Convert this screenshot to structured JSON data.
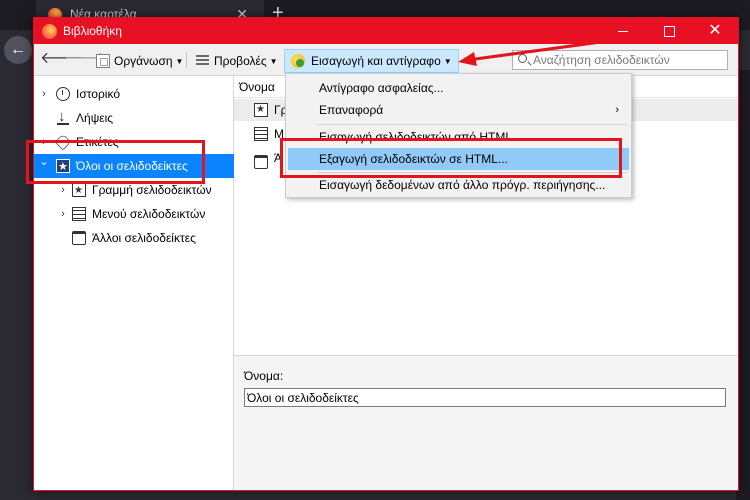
{
  "browser": {
    "tab_title": "Νέα καρτέλα",
    "tab_close": "✕",
    "new_tab": "+",
    "back": "←"
  },
  "window": {
    "title": "Βιβλιοθήκη",
    "minimize": "",
    "maximize": "",
    "close": "✕",
    "accent_color": "#e81123"
  },
  "toolbar": {
    "back": "🡐",
    "forward": "🡒",
    "organize": "Οργάνωση",
    "views": "Προβολές",
    "import_backup": "Εισαγωγή και αντίγραφο",
    "search_placeholder": "Αναζήτηση σελιδοδεικτών"
  },
  "sidebar": {
    "items": [
      {
        "label": "Ιστορικό",
        "icon": "clock-icon",
        "twisty": "›"
      },
      {
        "label": "Λήψεις",
        "icon": "download-icon",
        "twisty": ""
      },
      {
        "label": "Ετικέτες",
        "icon": "tag-icon",
        "twisty": "›"
      },
      {
        "label": "Όλοι οι σελιδοδείκτες",
        "icon": "bookmark-star-icon",
        "twisty": "⌄",
        "selected": true
      },
      {
        "label": "Γραμμή σελιδοδεικτών",
        "icon": "bookmarks-toolbar-icon",
        "twisty": "›"
      },
      {
        "label": "Μενού σελιδοδεικτών",
        "icon": "bookmarks-menu-icon",
        "twisty": "›"
      },
      {
        "label": "Άλλοι σελιδοδείκτες",
        "icon": "other-bookmarks-icon",
        "twisty": ""
      }
    ],
    "selected_color": "#0a84ff"
  },
  "list": {
    "column_name": "Όνομα",
    "rows": [
      {
        "label": "Γρ",
        "icon": "bookmarks-toolbar-icon"
      },
      {
        "label": "Μ",
        "icon": "bookmarks-menu-icon"
      },
      {
        "label": "Ά",
        "icon": "other-bookmarks-icon"
      }
    ]
  },
  "details": {
    "name_label": "Όνομα:",
    "name_value": "Όλοι οι σελιδοδείκτες"
  },
  "menu": {
    "items": [
      {
        "label": "Αντίγραφο ασφαλείας..."
      },
      {
        "label": "Επαναφορά",
        "submenu": "›"
      },
      {
        "label": "Εισαγωγή σελιδοδεικτών από HTML..."
      },
      {
        "label": "Εξαγωγή σελιδοδεικτών σε HTML...",
        "highlighted": true
      },
      {
        "label": "Εισαγωγή δεδομένων από άλλο πρόγρ. περιήγησης..."
      }
    ],
    "highlight_color": "#91c9f7"
  },
  "annotations": {
    "color": "#e3141e"
  }
}
